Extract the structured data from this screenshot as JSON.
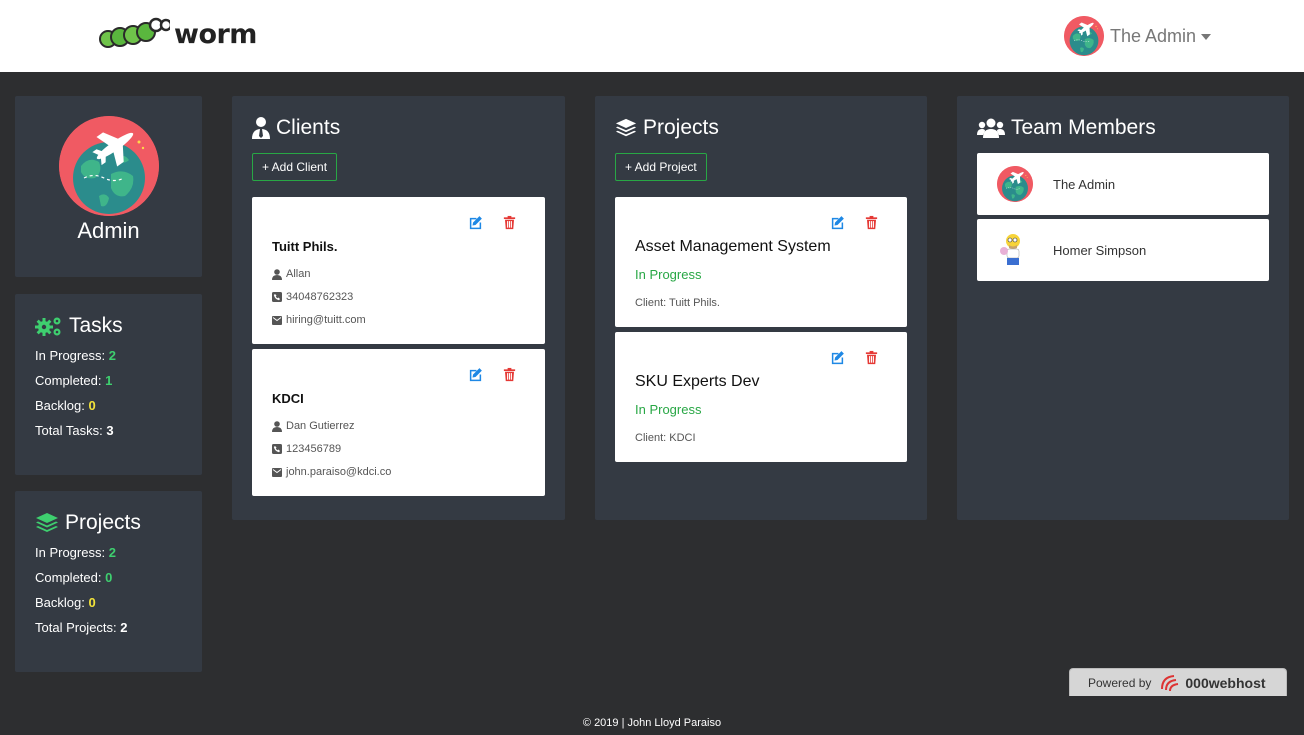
{
  "navbar": {
    "logo_text": "worm",
    "user_name": "The Admin"
  },
  "profile": {
    "role": "Admin"
  },
  "tasks": {
    "title": "Tasks",
    "in_progress_label": "In Progress:",
    "in_progress": "2",
    "completed_label": "Completed:",
    "completed": "1",
    "backlog_label": "Backlog:",
    "backlog": "0",
    "total_label": "Total Tasks:",
    "total": "3"
  },
  "projects_summary": {
    "title": "Projects",
    "in_progress_label": "In Progress:",
    "in_progress": "2",
    "completed_label": "Completed:",
    "completed": "0",
    "backlog_label": "Backlog:",
    "backlog": "0",
    "total_label": "Total Projects:",
    "total": "2"
  },
  "clients": {
    "title": "Clients",
    "add_label": "+ Add Client",
    "items": [
      {
        "name": "Tuitt Phils.",
        "contact": "Allan",
        "phone": "34048762323",
        "email": "hiring@tuitt.com"
      },
      {
        "name": "KDCI",
        "contact": "Dan Gutierrez",
        "phone": "123456789",
        "email": "john.paraiso@kdci.co"
      }
    ]
  },
  "projects": {
    "title": "Projects",
    "add_label": "+ Add Project",
    "items": [
      {
        "name": "Asset Management System",
        "status": "In Progress",
        "client": "Client: Tuitt Phils."
      },
      {
        "name": "SKU Experts Dev",
        "status": "In Progress",
        "client": "Client: KDCI"
      }
    ]
  },
  "team": {
    "title": "Team Members",
    "members": [
      {
        "name": "The Admin"
      },
      {
        "name": "Homer Simpson"
      }
    ]
  },
  "footer": {
    "text": "© 2019 | John Lloyd Paraiso"
  },
  "powered": {
    "label": "Powered by",
    "brand": "000webhost"
  },
  "colors": {
    "background": "#2d2e30",
    "panel": "#343a43",
    "accent_green": "#28a745",
    "value_green": "#3ecf6f",
    "value_yellow": "#f3e33a",
    "edit_blue": "#1e88e5",
    "delete_red": "#e53935"
  }
}
